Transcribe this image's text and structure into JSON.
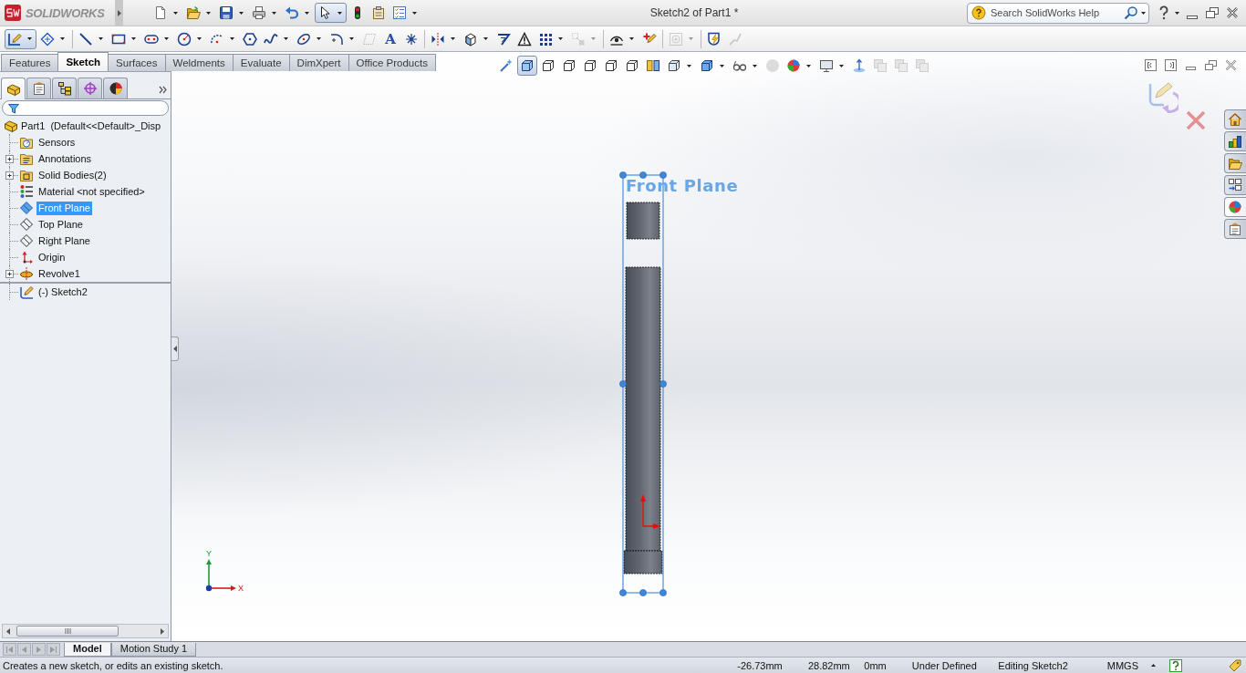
{
  "title_bar": {
    "logo": "SOLIDWORKS",
    "title": "Sketch2 of Part1 *",
    "search": {
      "placeholder": "Search SolidWorks Help"
    }
  },
  "quick_access": [
    {
      "kind": "new",
      "dropdown": true,
      "pressed": false,
      "disabled": false
    },
    {
      "kind": "open",
      "dropdown": true,
      "pressed": false,
      "disabled": false
    },
    {
      "kind": "save",
      "dropdown": true,
      "pressed": false,
      "disabled": false
    },
    {
      "kind": "print",
      "dropdown": true,
      "pressed": false,
      "disabled": false
    },
    {
      "kind": "undo",
      "dropdown": true,
      "pressed": false,
      "disabled": false
    },
    {
      "kind": "select",
      "dropdown": true,
      "pressed": true,
      "disabled": false
    },
    {
      "kind": "rebuild",
      "dropdown": false,
      "pressed": false,
      "disabled": false
    },
    {
      "kind": "options",
      "dropdown": false,
      "pressed": false,
      "disabled": false
    },
    {
      "kind": "properties",
      "dropdown": true,
      "pressed": false,
      "disabled": false
    }
  ],
  "sketch_toolbar": {
    "groups": [
      {
        "items": [
          {
            "kind": "sketch",
            "dropdown": true,
            "pressed": true,
            "disabled": false
          },
          {
            "kind": "dimension",
            "dropdown": true,
            "pressed": false,
            "disabled": false
          }
        ]
      },
      {
        "items": [
          {
            "kind": "line",
            "dropdown": true,
            "pressed": false,
            "disabled": false
          },
          {
            "kind": "rectangle",
            "dropdown": true,
            "pressed": false,
            "disabled": false
          },
          {
            "kind": "slot",
            "dropdown": true,
            "pressed": false,
            "disabled": false
          },
          {
            "kind": "circle",
            "dropdown": true,
            "pressed": false,
            "disabled": false
          },
          {
            "kind": "arc",
            "dropdown": true,
            "pressed": false,
            "disabled": false
          },
          {
            "kind": "polygon",
            "dropdown": false,
            "pressed": false,
            "disabled": false
          },
          {
            "kind": "spline",
            "dropdown": true,
            "pressed": false,
            "disabled": false
          },
          {
            "kind": "ellipse",
            "dropdown": true,
            "pressed": false,
            "disabled": false
          },
          {
            "kind": "fillet",
            "dropdown": true,
            "pressed": false,
            "disabled": false
          },
          {
            "kind": "plane",
            "dropdown": false,
            "pressed": false,
            "disabled": true
          },
          {
            "kind": "text",
            "glyph": "A",
            "dropdown": false,
            "pressed": false,
            "disabled": false
          },
          {
            "kind": "point",
            "dropdown": false,
            "pressed": false,
            "disabled": false
          }
        ]
      },
      {
        "items": [
          {
            "kind": "mirror",
            "dropdown": true,
            "pressed": false,
            "disabled": false
          },
          {
            "kind": "convert",
            "dropdown": true,
            "pressed": false,
            "disabled": false
          },
          {
            "kind": "offset",
            "dropdown": false,
            "pressed": false,
            "disabled": false
          },
          {
            "kind": "repair",
            "dropdown": false,
            "pressed": false,
            "disabled": false
          },
          {
            "kind": "pattern",
            "dropdown": true,
            "pressed": false,
            "disabled": false
          },
          {
            "kind": "move",
            "dropdown": true,
            "pressed": false,
            "disabled": true
          }
        ]
      },
      {
        "items": [
          {
            "kind": "relations",
            "dropdown": true,
            "pressed": false,
            "disabled": false
          },
          {
            "kind": "add_relation",
            "dropdown": false,
            "pressed": false,
            "disabled": false
          }
        ]
      },
      {
        "items": [
          {
            "kind": "target",
            "dropdown": true,
            "pressed": false,
            "disabled": true
          }
        ]
      },
      {
        "items": [
          {
            "kind": "rapid",
            "dropdown": false,
            "pressed": false,
            "disabled": false
          },
          {
            "kind": "instant",
            "dropdown": false,
            "pressed": false,
            "disabled": true
          }
        ]
      }
    ]
  },
  "command_tabs": [
    {
      "label": "Features",
      "selected": false
    },
    {
      "label": "Sketch",
      "selected": true
    },
    {
      "label": "Surfaces",
      "selected": false
    },
    {
      "label": "Weldments",
      "selected": false
    },
    {
      "label": "Evaluate",
      "selected": false
    },
    {
      "label": "DimXpert",
      "selected": false
    },
    {
      "label": "Office Products",
      "selected": false
    }
  ],
  "view_toolbar": [
    {
      "kind": "zoom_previous",
      "dropdown": false,
      "pressed": false,
      "disabled": false
    },
    {
      "kind": "shaded_edges",
      "dropdown": false,
      "pressed": true,
      "disabled": false
    },
    {
      "kind": "cube_outline",
      "dropdown": false,
      "pressed": false,
      "disabled": false
    },
    {
      "kind": "cube_outline",
      "dropdown": false,
      "pressed": false,
      "disabled": false
    },
    {
      "kind": "cube_outline",
      "dropdown": false,
      "pressed": false,
      "disabled": false
    },
    {
      "kind": "cube_outline",
      "dropdown": false,
      "pressed": false,
      "disabled": false
    },
    {
      "kind": "cube_outline",
      "dropdown": false,
      "pressed": false,
      "disabled": false
    },
    {
      "kind": "section_view",
      "dropdown": false,
      "pressed": false,
      "disabled": false
    },
    {
      "kind": "view_orientation",
      "dropdown": true,
      "pressed": false,
      "disabled": false
    },
    {
      "kind": "display_style",
      "dropdown": true,
      "pressed": false,
      "disabled": false
    },
    {
      "kind": "hide_show",
      "dropdown": true,
      "pressed": false,
      "disabled": false
    },
    {
      "kind": "sphere",
      "dropdown": false,
      "pressed": false,
      "disabled": true
    },
    {
      "kind": "appearance",
      "dropdown": true,
      "pressed": false,
      "disabled": false
    },
    {
      "kind": "scene",
      "dropdown": true,
      "pressed": false,
      "disabled": false
    },
    {
      "kind": "view_axis",
      "dropdown": false,
      "pressed": false,
      "disabled": false
    },
    {
      "kind": "layer",
      "dropdown": false,
      "pressed": false,
      "disabled": true
    },
    {
      "kind": "layer",
      "dropdown": false,
      "pressed": false,
      "disabled": true
    },
    {
      "kind": "layer",
      "dropdown": false,
      "pressed": false,
      "disabled": true
    }
  ],
  "panel_tabs": [
    {
      "kind": "feature_manager",
      "selected": true
    },
    {
      "kind": "property_manager",
      "selected": false
    },
    {
      "kind": "configuration_manager",
      "selected": false
    },
    {
      "kind": "dimxpert_manager",
      "selected": false
    },
    {
      "kind": "display_manager",
      "selected": false
    }
  ],
  "feature_tree": {
    "root": {
      "label": "Part1  (Default<<Default>_Disp",
      "kind": "part",
      "selected": false,
      "children": [
        {
          "label": "Sensors",
          "kind": "sensors",
          "selected": false,
          "editing": false
        },
        {
          "label": "Annotations",
          "kind": "annotations",
          "selected": false,
          "expanded": false,
          "editing": false
        },
        {
          "label": "Solid Bodies(2)",
          "kind": "bodies",
          "selected": false,
          "expanded": false,
          "editing": false
        },
        {
          "label": "Material <not specified>",
          "kind": "material",
          "selected": false,
          "editing": false
        },
        {
          "label": "Front Plane",
          "kind": "plane",
          "selected": true,
          "editing": false
        },
        {
          "label": "Top Plane",
          "kind": "plane",
          "selected": false,
          "editing": false
        },
        {
          "label": "Right Plane",
          "kind": "plane",
          "selected": false,
          "editing": false
        },
        {
          "label": "Origin",
          "kind": "origin",
          "selected": false,
          "editing": false
        },
        {
          "label": "Revolve1",
          "kind": "revolve",
          "selected": false,
          "expanded": false,
          "editing": false
        },
        {
          "label": "(-) Sketch2",
          "kind": "sketch",
          "selected": false,
          "editing": true
        }
      ]
    }
  },
  "viewport": {
    "plane_label": "Front Plane",
    "triad": {
      "x_label": "X",
      "y_label": "Y"
    }
  },
  "task_pane": [
    {
      "kind": "home",
      "selected": false
    },
    {
      "kind": "library",
      "selected": false
    },
    {
      "kind": "explorer",
      "selected": false
    },
    {
      "kind": "view_palette",
      "selected": false
    },
    {
      "kind": "appearances",
      "selected": true
    },
    {
      "kind": "custom_properties",
      "selected": false
    }
  ],
  "bottom_tabs": [
    {
      "label": "Model",
      "selected": true
    },
    {
      "label": "Motion Study 1",
      "selected": false
    }
  ],
  "status_bar": {
    "message": "Creates a new sketch, or edits an existing sketch.",
    "coordinates": [
      "-26.73mm",
      "28.82mm",
      "0mm"
    ],
    "sketch_state": "Under Defined",
    "mode": "Editing Sketch2",
    "units": "MMGS"
  }
}
